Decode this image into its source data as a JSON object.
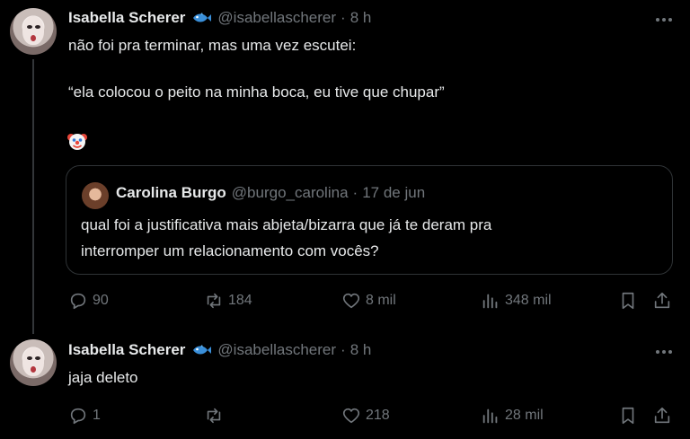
{
  "tweets": [
    {
      "author": "Isabella Scherer",
      "handle": "@isabellascherer",
      "separator": "·",
      "time": "8 h",
      "lines": [
        "não foi pra terminar, mas uma vez escutei:",
        "“ela colocou o peito na minha boca, eu tive que chupar”"
      ],
      "emoji": "clown-face",
      "quote": {
        "author": "Carolina Burgo",
        "handle": "@burgo_carolina",
        "separator": "·",
        "time": "17 de jun",
        "lines": [
          "qual foi a justificativa mais abjeta/bizarra que já te deram pra",
          "interromper um relacionamento com vocês?"
        ]
      },
      "actions": {
        "replies": "90",
        "retweets": "184",
        "likes": "8 mil",
        "views": "348 mil"
      }
    },
    {
      "author": "Isabella Scherer",
      "handle": "@isabellascherer",
      "separator": "·",
      "time": "8 h",
      "lines": [
        "jaja deleto"
      ],
      "actions": {
        "replies": "1",
        "retweets": "",
        "likes": "218",
        "views": "28 mil"
      }
    }
  ],
  "colors": {
    "background": "#000000",
    "text": "#e7e9ea",
    "muted": "#71767b",
    "border": "#2f3336"
  }
}
